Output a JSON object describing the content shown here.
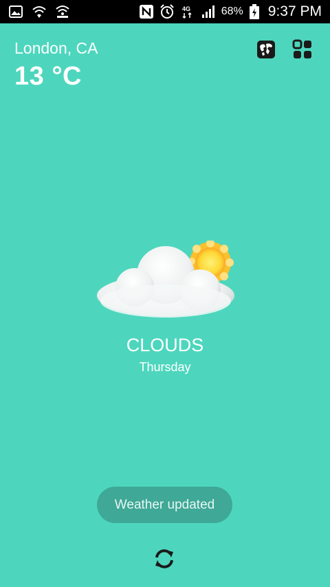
{
  "status_bar": {
    "battery_percent": "68%",
    "time": "9:37 PM",
    "icons": [
      "gallery-icon",
      "wifi-icon",
      "hotspot-icon",
      "nfc-icon",
      "alarm-icon",
      "4g-icon",
      "signal-icon",
      "battery-charging-icon"
    ]
  },
  "weather": {
    "location": "London, CA",
    "temperature": "13 °C",
    "condition": "CLOUDS",
    "day": "Thursday",
    "icon": "cloud-sun-icon"
  },
  "toolbar": {
    "world_icon": "world-map-icon",
    "menu_icon": "grid-menu-icon"
  },
  "toast": {
    "message": "Weather updated"
  },
  "footer": {
    "refresh_icon": "refresh-icon"
  },
  "colors": {
    "background": "#4dd6bd",
    "toast": "#3fa897"
  }
}
